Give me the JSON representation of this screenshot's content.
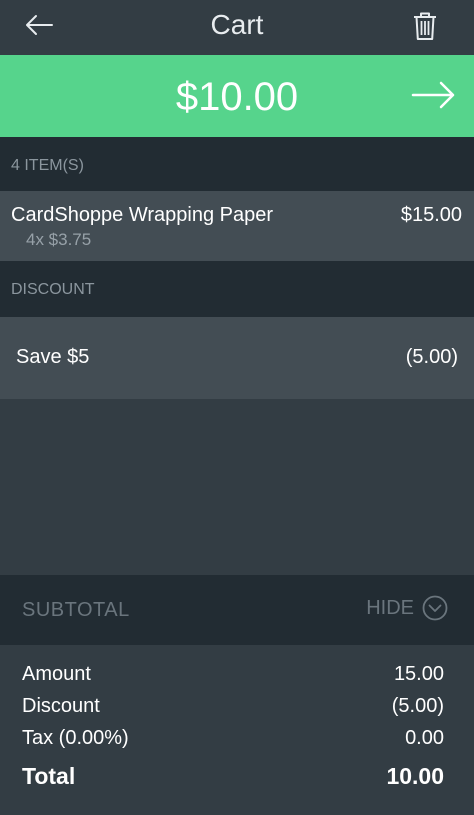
{
  "header": {
    "title": "Cart",
    "back_icon": "arrow-left-icon",
    "trash_icon": "trash-icon"
  },
  "pay_bar": {
    "amount": "$10.00",
    "icon": "arrow-right-icon",
    "color": "#56d48c"
  },
  "items_section": {
    "header": "4 ITEM(S)",
    "items": [
      {
        "name": "CardShoppe Wrapping Paper",
        "quantity_detail": "4x $3.75",
        "price": "$15.00"
      }
    ]
  },
  "discount_section": {
    "header": "DISCOUNT",
    "discounts": [
      {
        "name": "Save $5",
        "value": "(5.00)"
      }
    ]
  },
  "subtotal": {
    "label": "SUBTOTAL",
    "toggle_label": "HIDE",
    "toggle_icon": "chevron-down-circle-icon"
  },
  "totals": {
    "amount_label": "Amount",
    "amount_value": "15.00",
    "discount_label": "Discount",
    "discount_value": "(5.00)",
    "tax_label": "Tax (0.00%)",
    "tax_value": "0.00",
    "total_label": "Total",
    "total_value": "10.00"
  }
}
